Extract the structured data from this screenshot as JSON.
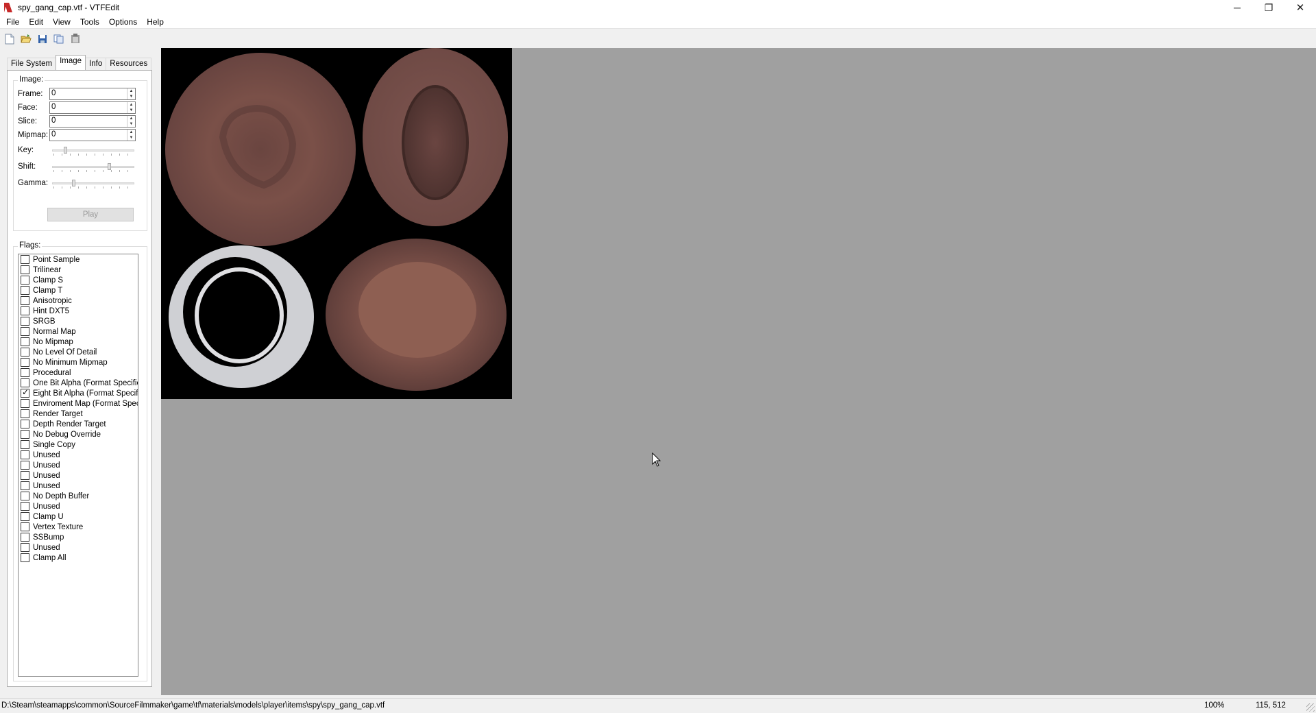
{
  "window": {
    "title": "spy_gang_cap.vtf - VTFEdit",
    "minimize": "─",
    "restore": "❐",
    "close": "✕"
  },
  "menu": [
    "File",
    "Edit",
    "View",
    "Tools",
    "Options",
    "Help"
  ],
  "toolbar": {
    "icons": [
      "new-file-icon",
      "open-folder-icon",
      "save-icon",
      "copy-icon",
      "paste-icon"
    ]
  },
  "tabs": [
    {
      "label": "File System",
      "active": false
    },
    {
      "label": "Image",
      "active": true
    },
    {
      "label": "Info",
      "active": false
    },
    {
      "label": "Resources",
      "active": false
    }
  ],
  "image_group": {
    "label": "Image:",
    "frame": {
      "label": "Frame:",
      "value": "0"
    },
    "face": {
      "label": "Face:",
      "value": "0"
    },
    "slice": {
      "label": "Slice:",
      "value": "0"
    },
    "mipmap": {
      "label": "Mipmap:",
      "value": "0"
    },
    "key": {
      "label": "Key:",
      "level": 0.15
    },
    "shift": {
      "label": "Shift:",
      "level": 0.7
    },
    "gamma": {
      "label": "Gamma:",
      "level": 0.25
    },
    "play": "Play"
  },
  "flags_group": {
    "label": "Flags:",
    "items": [
      {
        "label": "Point Sample",
        "checked": false
      },
      {
        "label": "Trilinear",
        "checked": false
      },
      {
        "label": "Clamp S",
        "checked": false
      },
      {
        "label": "Clamp T",
        "checked": false
      },
      {
        "label": "Anisotropic",
        "checked": false
      },
      {
        "label": "Hint DXT5",
        "checked": false
      },
      {
        "label": "SRGB",
        "checked": false
      },
      {
        "label": "Normal Map",
        "checked": false
      },
      {
        "label": "No Mipmap",
        "checked": false
      },
      {
        "label": "No Level Of Detail",
        "checked": false
      },
      {
        "label": "No Minimum Mipmap",
        "checked": false
      },
      {
        "label": "Procedural",
        "checked": false
      },
      {
        "label": "One Bit Alpha (Format Specific)",
        "checked": false
      },
      {
        "label": "Eight Bit Alpha (Format Specific)",
        "checked": true
      },
      {
        "label": "Enviroment Map (Format Specific)",
        "checked": false
      },
      {
        "label": "Render Target",
        "checked": false
      },
      {
        "label": "Depth Render Target",
        "checked": false
      },
      {
        "label": "No Debug Override",
        "checked": false
      },
      {
        "label": "Single Copy",
        "checked": false
      },
      {
        "label": "Unused",
        "checked": false
      },
      {
        "label": "Unused",
        "checked": false
      },
      {
        "label": "Unused",
        "checked": false
      },
      {
        "label": "Unused",
        "checked": false
      },
      {
        "label": "No Depth Buffer",
        "checked": false
      },
      {
        "label": "Unused",
        "checked": false
      },
      {
        "label": "Clamp U",
        "checked": false
      },
      {
        "label": "Vertex Texture",
        "checked": false
      },
      {
        "label": "SSBump",
        "checked": false
      },
      {
        "label": "Unused",
        "checked": false
      },
      {
        "label": "Clamp All",
        "checked": false
      }
    ]
  },
  "status": {
    "path": "D:\\Steam\\steamapps\\common\\SourceFilmmaker\\game\\tf\\materials\\models\\player\\items\\spy\\spy_gang_cap.vtf",
    "zoom": "100%",
    "coords": "115, 512"
  },
  "colors": {
    "viewport_bg": "#a0a0a0",
    "texture_bg": "#000000",
    "cap_brown": "#6b4640",
    "cap_light": "#8a5a50",
    "ring_white": "#d8d8da"
  }
}
